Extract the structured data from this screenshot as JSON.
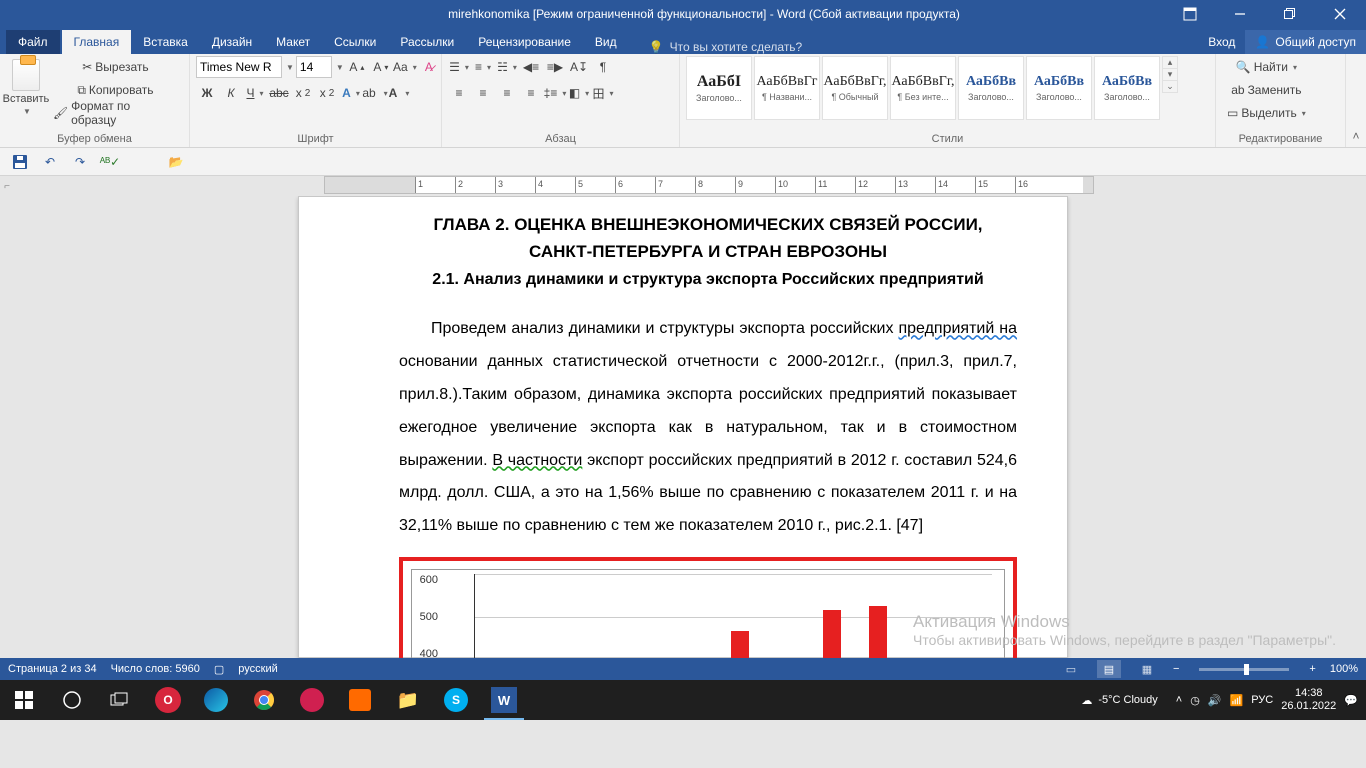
{
  "title": "mirehkonomika [Режим ограниченной функциональности] - Word (Сбой активации продукта)",
  "tabs": {
    "file": "Файл",
    "items": [
      "Главная",
      "Вставка",
      "Дизайн",
      "Макет",
      "Ссылки",
      "Рассылки",
      "Рецензирование",
      "Вид"
    ],
    "active": 0,
    "tell": "Что вы хотите сделать?",
    "signin": "Вход",
    "share": "Общий доступ"
  },
  "ribbon": {
    "clipboard": {
      "title": "Буфер обмена",
      "paste": "Вставить",
      "cut": "Вырезать",
      "copy": "Копировать",
      "format": "Формат по образцу"
    },
    "font": {
      "title": "Шрифт",
      "family": "Times New R",
      "size": "14"
    },
    "para": {
      "title": "Абзац"
    },
    "styles": {
      "title": "Стили",
      "items": [
        {
          "preview": "АаБбІ",
          "name": "Заголово...",
          "cls": "bold"
        },
        {
          "preview": "АаБбВвГг",
          "name": "¶ Названи..."
        },
        {
          "preview": "АаБбВвГг,",
          "name": "¶ Обычный"
        },
        {
          "preview": "АаБбВвГг,",
          "name": "¶ Без инте..."
        },
        {
          "preview": "АаБбВв",
          "name": "Заголово...",
          "cls": "blue"
        },
        {
          "preview": "АаБбВв",
          "name": "Заголово...",
          "cls": "blue"
        },
        {
          "preview": "АаБбВв",
          "name": "Заголово...",
          "cls": "blue"
        }
      ]
    },
    "editing": {
      "title": "Редактирование",
      "find": "Найти",
      "replace": "Заменить",
      "select": "Выделить"
    }
  },
  "ruler_ticks": [
    "1",
    "2",
    "3",
    "4",
    "5",
    "6",
    "7",
    "8",
    "9",
    "10",
    "11",
    "12",
    "13",
    "14",
    "15",
    "16"
  ],
  "doc": {
    "h1a": "ГЛАВА 2. ОЦЕНКА ВНЕШНЕЭКОНОМИЧЕСКИХ СВЯЗЕЙ РОССИИ,",
    "h1b": "САНКТ-ПЕТЕРБУРГА И СТРАН ЕВРОЗОНЫ",
    "h2": "2.1. Анализ динамики и структура экспорта Российских предприятий",
    "p1_a": "Проведем анализ динамики и структуры экспорта российских ",
    "p1_link": "предприятий на",
    "p1_b": " основании данных статистической отчетности с 2000-2012г.г., (прил.3, прил.7, прил.8.).Таким образом, динамика экспорта российских предприятий показывает ежегодное увеличение экспорта как в натуральном, так и в стоимостном выражении. ",
    "p1_wavy": "В частности",
    "p1_c": " экспорт российских предприятий в 2012 г. составил 524,6 млрд. долл. США, а это на 1,56% выше по сравнению с показателем 2011 г. и на 32,11% выше по сравнению с тем же показателем 2010 г., рис.2.1. [47]"
  },
  "chart_data": {
    "type": "bar",
    "ylim": [
      400,
      600
    ],
    "yticks": [
      "600",
      "500",
      "400"
    ],
    "values": [
      465,
      398,
      515,
      525
    ]
  },
  "watermark": {
    "l1": "Активация Windows",
    "l2": "Чтобы активировать Windows, перейдите в раздел \"Параметры\"."
  },
  "status": {
    "page": "Страница 2 из 34",
    "words": "Число слов: 5960",
    "lang": "русский",
    "zoom": "100%"
  },
  "taskbar": {
    "weather": "-5°C Cloudy",
    "time": "14:38",
    "date": "26.01.2022",
    "lang": "РУС"
  }
}
